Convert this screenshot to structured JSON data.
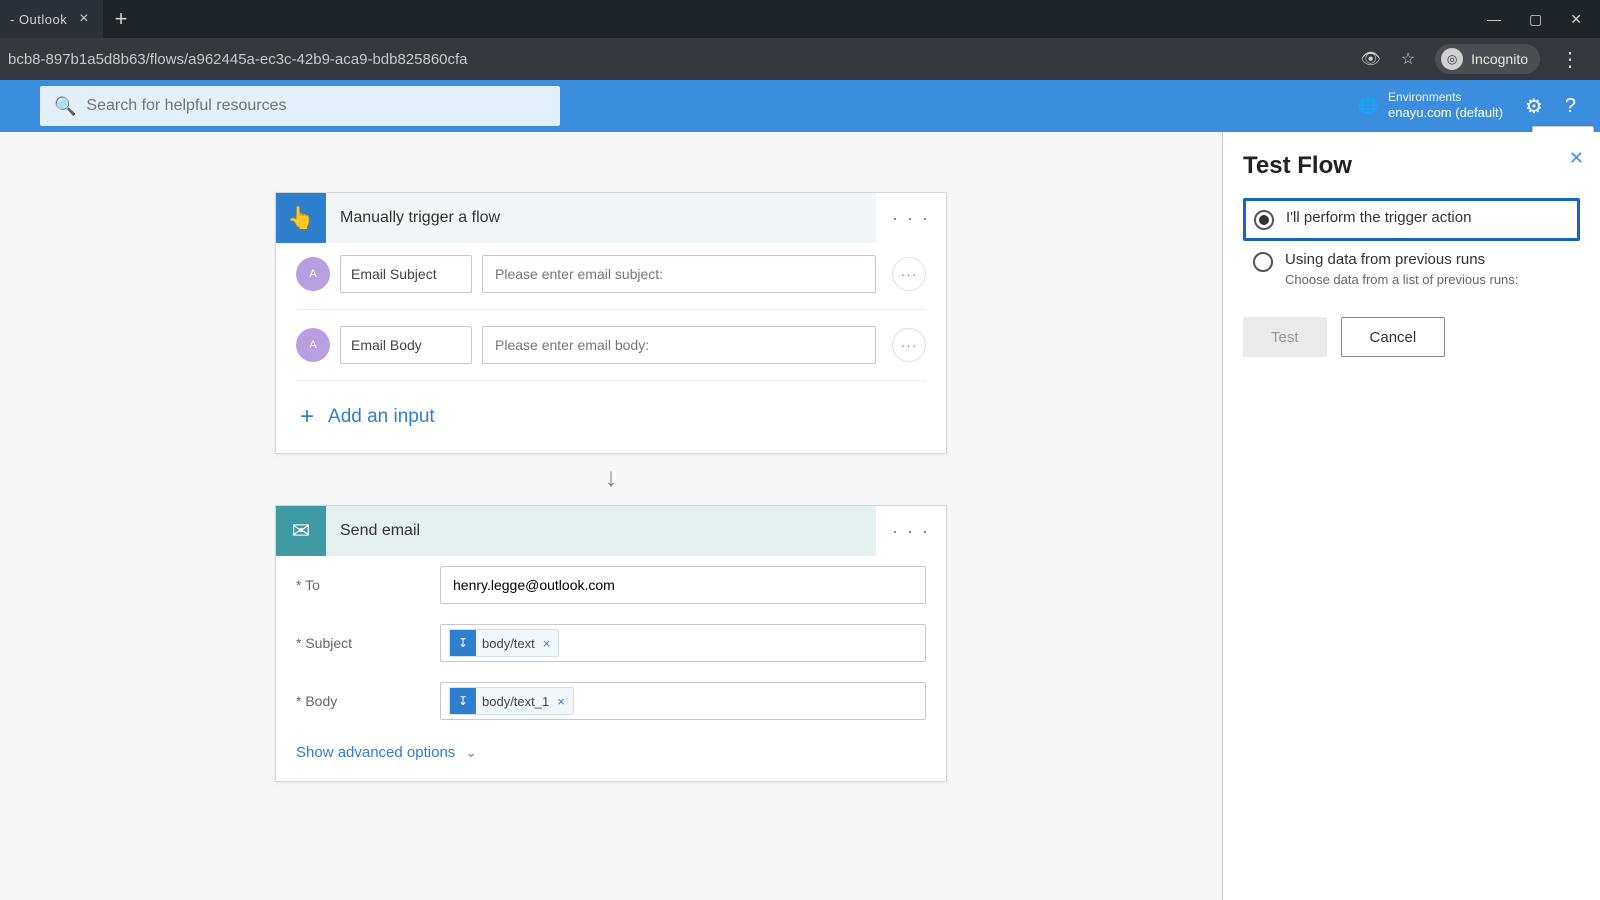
{
  "browser": {
    "tab_title": "- Outlook",
    "url": "bcb8-897b1a5d8b63/flows/a962445a-ec3c-42b9-aca9-bdb825860cfa",
    "incognito_label": "Incognito"
  },
  "header": {
    "search_placeholder": "Search for helpful resources",
    "env_label": "Environments",
    "env_value": "enayu.com (default)",
    "close_tooltip": "Close"
  },
  "trigger_card": {
    "title": "Manually trigger a flow",
    "inputs": [
      {
        "name": "Email Subject",
        "placeholder": "Please enter email subject:"
      },
      {
        "name": "Email Body",
        "placeholder": "Please enter email body:"
      }
    ],
    "add_input": "Add an input"
  },
  "action_card": {
    "title": "Send email",
    "to_label": "* To",
    "to_value": "henry.legge@outlook.com",
    "subject_label": "* Subject",
    "subject_token": "body/text",
    "body_label": "* Body",
    "body_token": "body/text_1",
    "show_adv": "Show advanced options"
  },
  "panel": {
    "title": "Test Flow",
    "opt1": "I'll perform the trigger action",
    "opt2": "Using data from previous runs",
    "opt2_sub": "Choose data from a list of previous runs:",
    "test": "Test",
    "cancel": "Cancel"
  }
}
